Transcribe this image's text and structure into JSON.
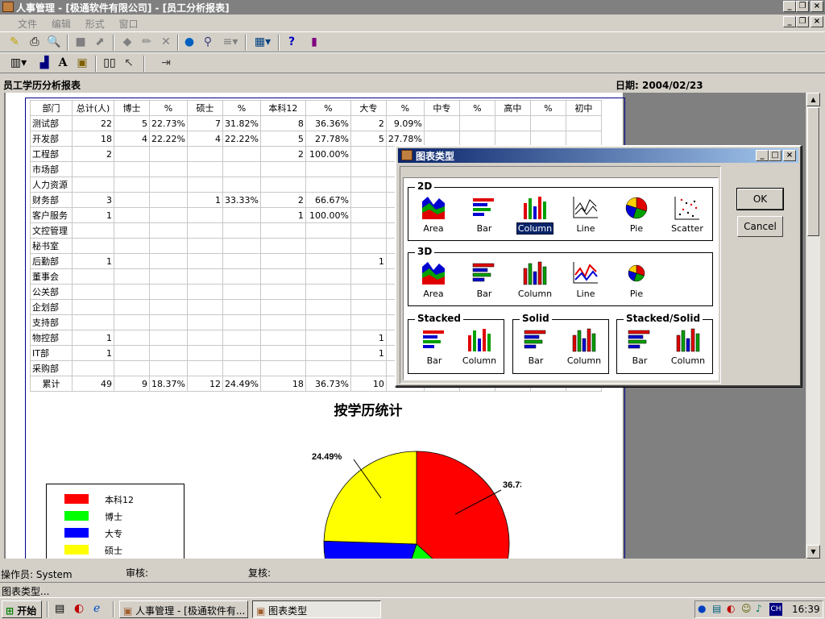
{
  "app": {
    "title": "人事管理 - [极通软件有限公司] - [员工分析报表]"
  },
  "menu": [
    "文件",
    "编辑",
    "形式",
    "窗口"
  ],
  "report": {
    "title": "员工学历分析报表",
    "date_label": "日期: 2004/02/23"
  },
  "table": {
    "headers": [
      "部门",
      "总计(人)",
      "博士",
      "%",
      "硕士",
      "%",
      "本科12",
      "%",
      "大专",
      "%",
      "中专",
      "%",
      "高中",
      "%",
      "初中"
    ],
    "rows": [
      [
        "测试部",
        "22",
        "5",
        "22.73%",
        "7",
        "31.82%",
        "8",
        "36.36%",
        "2",
        "9.09%",
        "",
        "",
        "",
        "",
        ""
      ],
      [
        "开发部",
        "18",
        "4",
        "22.22%",
        "4",
        "22.22%",
        "5",
        "27.78%",
        "5",
        "27.78%",
        "",
        "",
        "",
        "",
        ""
      ],
      [
        "工程部",
        "2",
        "",
        "",
        "",
        "",
        "2",
        "100.00%",
        "",
        "",
        "",
        "",
        "",
        "",
        ""
      ],
      [
        "市场部",
        "",
        "",
        "",
        "",
        "",
        "",
        "",
        "",
        "",
        "",
        "",
        "",
        "",
        ""
      ],
      [
        "人力资源",
        "",
        "",
        "",
        "",
        "",
        "",
        "",
        "",
        "",
        "",
        "",
        "",
        "",
        ""
      ],
      [
        "财务部",
        "3",
        "",
        "",
        "1",
        "33.33%",
        "2",
        "66.67%",
        "",
        "",
        "",
        "",
        "",
        "",
        ""
      ],
      [
        "客户服务",
        "1",
        "",
        "",
        "",
        "",
        "1",
        "100.00%",
        "",
        "",
        "",
        "",
        "",
        "",
        ""
      ],
      [
        "文控管理",
        "",
        "",
        "",
        "",
        "",
        "",
        "",
        "",
        "",
        "",
        "",
        "",
        "",
        ""
      ],
      [
        "秘书室",
        "",
        "",
        "",
        "",
        "",
        "",
        "",
        "",
        "",
        "",
        "",
        "",
        "",
        ""
      ],
      [
        "后勤部",
        "1",
        "",
        "",
        "",
        "",
        "",
        "",
        "1",
        "100.",
        "",
        "",
        "",
        "",
        ""
      ],
      [
        "董事会",
        "",
        "",
        "",
        "",
        "",
        "",
        "",
        "",
        "",
        "",
        "",
        "",
        "",
        ""
      ],
      [
        "公关部",
        "",
        "",
        "",
        "",
        "",
        "",
        "",
        "",
        "",
        "",
        "",
        "",
        "",
        ""
      ],
      [
        "企划部",
        "",
        "",
        "",
        "",
        "",
        "",
        "",
        "",
        "",
        "",
        "",
        "",
        "",
        ""
      ],
      [
        "支持部",
        "",
        "",
        "",
        "",
        "",
        "",
        "",
        "",
        "",
        "",
        "",
        "",
        "",
        ""
      ],
      [
        "物控部",
        "1",
        "",
        "",
        "",
        "",
        "",
        "",
        "1",
        "100.",
        "",
        "",
        "",
        "",
        ""
      ],
      [
        "IT部",
        "1",
        "",
        "",
        "",
        "",
        "",
        "",
        "1",
        "100.",
        "",
        "",
        "",
        "",
        ""
      ],
      [
        "采购部",
        "",
        "",
        "",
        "",
        "",
        "",
        "",
        "",
        "",
        "",
        "",
        "",
        "",
        ""
      ],
      [
        "累计",
        "49",
        "9",
        "18.37%",
        "12",
        "24.49%",
        "18",
        "36.73%",
        "10",
        "20.",
        "",
        "",
        "",
        "",
        ""
      ]
    ]
  },
  "chart_data": {
    "type": "pie",
    "title": "按学历统计",
    "legend": [
      "本科12",
      "博士",
      "大专",
      "硕士"
    ],
    "colors": [
      "#ff0000",
      "#00ff00",
      "#0000ff",
      "#ffff00"
    ],
    "values": [
      36.73,
      18.37,
      20.41,
      24.49
    ],
    "visible_labels": {
      "本科12": "36.73%",
      "硕士": "24.49%"
    }
  },
  "footer": {
    "operator": "操作员: System",
    "review": "审核:",
    "recheck": "复核:"
  },
  "status": "图表类型...",
  "taskbar": {
    "start": "开始",
    "tasks": [
      "人事管理 - [极通软件有...",
      "图表类型"
    ],
    "clock": "16:39",
    "ime": "CH"
  },
  "dialog": {
    "title": "图表类型",
    "groups": {
      "g2d": "2D",
      "g3d": "3D",
      "stacked": "Stacked",
      "solid": "Solid",
      "stackedsolid": "Stacked/Solid"
    },
    "types2d": [
      "Area",
      "Bar",
      "Column",
      "Line",
      "Pie",
      "Scatter"
    ],
    "types3d": [
      "Area",
      "Bar",
      "Column",
      "Line",
      "Pie"
    ],
    "stacked": [
      "Bar",
      "Column"
    ],
    "solid": [
      "Bar",
      "Column"
    ],
    "stackedsolid": [
      "Bar",
      "Column"
    ],
    "selected": "Column",
    "ok": "OK",
    "cancel": "Cancel"
  }
}
